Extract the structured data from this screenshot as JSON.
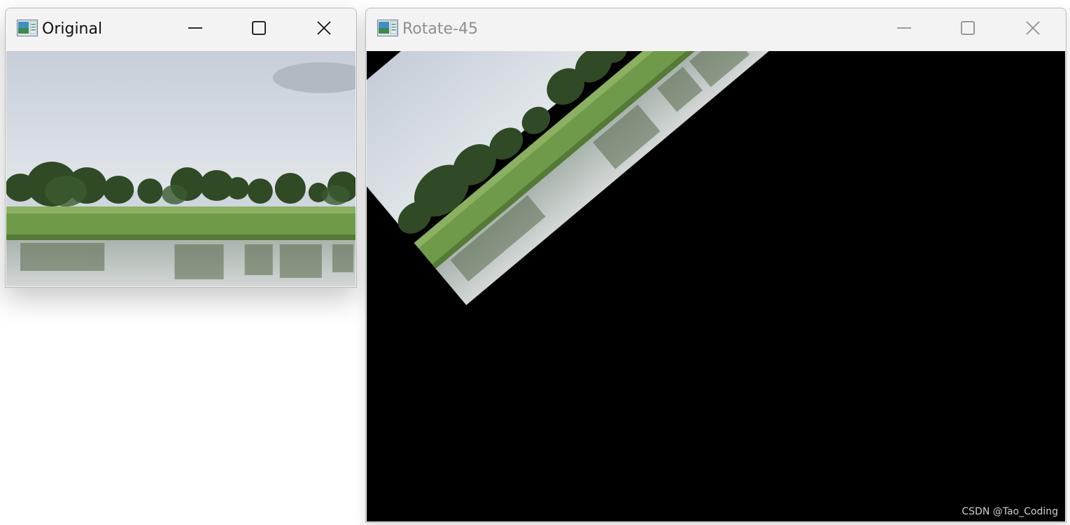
{
  "windows": {
    "original": {
      "title": "Original",
      "icon": "image-window-icon",
      "controls": [
        "minimize-icon",
        "maximize-icon",
        "close-icon"
      ]
    },
    "rotate": {
      "title": "Rotate-45",
      "icon": "image-window-icon",
      "controls": [
        "minimize-icon",
        "maximize-icon",
        "close-icon"
      ],
      "rotation_degrees": 45,
      "watermark": "CSDN @Tao_Coding"
    }
  },
  "colors": {
    "sky_top": "#c9d0d8",
    "sky_bottom": "#dde3e8",
    "trees": "#2e4a24",
    "grass": "#6f9a4a",
    "water": "#b9c2bd",
    "rotate_background": "#000000"
  }
}
